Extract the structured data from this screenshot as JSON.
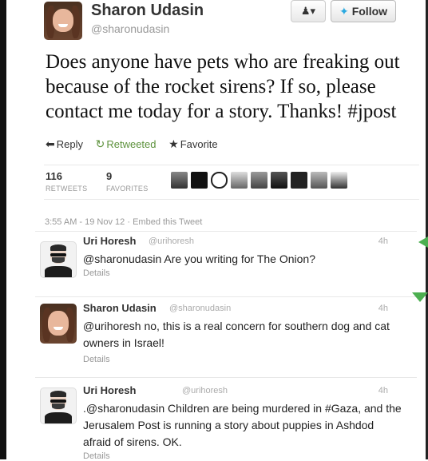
{
  "tweet": {
    "author_name": "Sharon Udasin",
    "author_handle": "@sharonudasin",
    "text": "Does anyone have pets who are freaking out because of the rocket sirens? If so, please contact me today for a story. Thanks! #jpost",
    "follow_label": "Follow",
    "actions": {
      "reply": "Reply",
      "retweeted": "Retweeted",
      "favorite": "Favorite"
    },
    "retweets_count": "116",
    "retweets_label": "RETWEETS",
    "favorites_count": "9",
    "favorites_label": "FAVORITES",
    "timestamp": "3:55 AM - 19 Nov 12",
    "embed_label": "Embed this Tweet"
  },
  "replies": [
    {
      "name": "Uri Horesh",
      "handle": "@urihoresh",
      "time": "4h",
      "text": "@sharonudasin Are you writing for The Onion?",
      "details": "Details"
    },
    {
      "name": "Sharon Udasin",
      "handle": "@sharonudasin",
      "time": "4h",
      "text": "@urihoresh no, this is a real concern for southern dog and cat owners in Israel!",
      "details": "Details"
    },
    {
      "name": "Uri Horesh",
      "handle": "@urihoresh",
      "time": "4h",
      "text": ".@sharonudasin Children are being murdered in #Gaza, and the Jerusalem Post is running a story about puppies in Ashdod afraid of sirens. OK.",
      "details": "Details"
    }
  ],
  "icons": {
    "reply": "reply-arrow-icon",
    "retweet": "retweet-icon",
    "favorite": "star-icon",
    "follow_bird": "twitter-bird-icon",
    "user_menu": "user-dropdown-icon"
  },
  "colors": {
    "retweeted_green": "#5c913b",
    "twitter_blue": "#2aa9e0",
    "reply_marker": "#4caf50"
  }
}
